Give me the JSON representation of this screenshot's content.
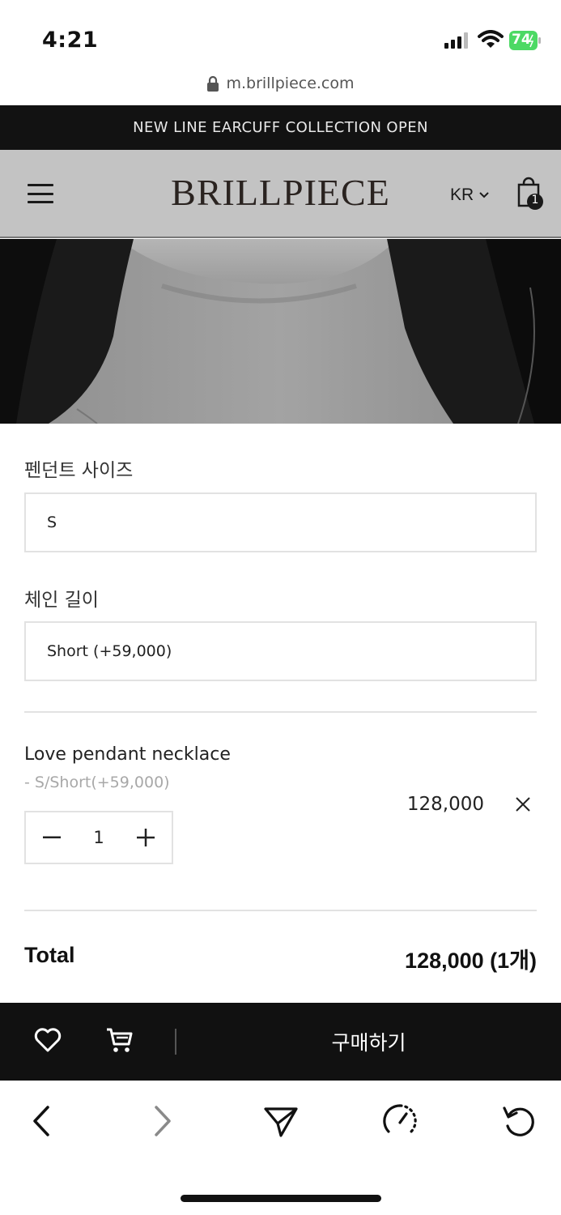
{
  "status_bar": {
    "time": "4:21",
    "battery_level": "74"
  },
  "browser": {
    "url": "m.brillpiece.com"
  },
  "announcement": {
    "text": "NEW LINE EARCUFF COLLECTION OPEN"
  },
  "header": {
    "logo": "BRILLPIECE",
    "language": "KR",
    "cart_count": "1"
  },
  "options": [
    {
      "label": "펜던트 사이즈",
      "value": "S"
    },
    {
      "label": "체인 길이",
      "value": "Short (+59,000)"
    }
  ],
  "cart_item": {
    "name": "Love pendant necklace",
    "option": "- S/Short(+59,000)",
    "quantity": "1",
    "price": "128,000"
  },
  "total": {
    "label": "Total",
    "value": "128,000 (1개)"
  },
  "action_bar": {
    "buy_label": "구매하기"
  },
  "icons": {
    "lock": "lock-icon",
    "menu": "hamburger-menu-icon",
    "cart": "shopping-bag-icon",
    "wishlist": "heart-icon",
    "add_to_cart": "shopping-cart-icon",
    "remove": "close-icon",
    "back": "chevron-left-icon",
    "forward": "chevron-right-icon",
    "share": "send-icon",
    "speed": "speedometer-icon",
    "reload": "reload-icon"
  },
  "colors": {
    "announcement_bg": "#121212",
    "header_bg": "#c3c3c3",
    "buy_bar_bg": "#111111",
    "battery_green": "#4cd964"
  }
}
